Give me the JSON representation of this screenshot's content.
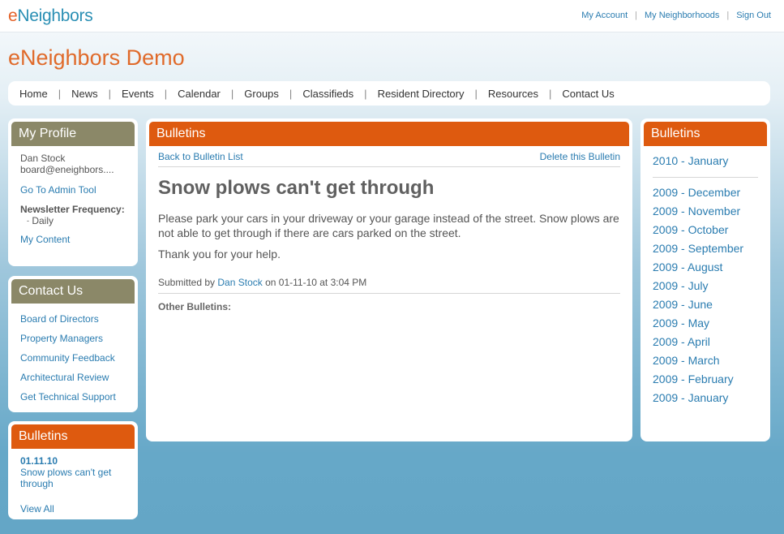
{
  "brand": {
    "logo_e": "e",
    "logo_rest": "Neighbors"
  },
  "toplinks": [
    "My Account",
    "My Neighborhoods",
    "Sign Out"
  ],
  "site_title": "eNeighbors Demo",
  "nav": [
    "Home",
    "News",
    "Events",
    "Calendar",
    "Groups",
    "Classifieds",
    "Resident Directory",
    "Resources",
    "Contact Us"
  ],
  "profile": {
    "title": "My Profile",
    "name": "Dan Stock",
    "email": "board@eneighbors....",
    "admin_link": "Go To Admin Tool",
    "newsletter_label": "Newsletter Frequency:",
    "newsletter_value": "Daily",
    "content_link": "My Content"
  },
  "contact": {
    "title": "Contact Us",
    "links": [
      "Board of Directors",
      "Property Managers",
      "Community Feedback",
      "Architectural Review",
      "Get Technical Support"
    ]
  },
  "bulletins_side": {
    "title": "Bulletins",
    "date": "01.11.10",
    "item": "Snow plows can't get through",
    "view_all": "View All"
  },
  "main": {
    "title": "Bulletins",
    "back_link": "Back to Bulletin List",
    "delete_link": "Delete this Bulletin",
    "bulletin_title": "Snow plows can't get through",
    "body": "Please park your cars in your driveway or your garage instead of the street. Snow plows are not able to get through if there are cars parked on the street.",
    "thanks": "Thank you for your help.",
    "submitted_prefix": "Submitted by",
    "author": "Dan Stock",
    "submitted_suffix": "on 01-11-10 at 3:04 PM",
    "other_label": "Other Bulletins:"
  },
  "archive": {
    "title": "Bulletins",
    "current": "2010 - January",
    "months": [
      "2009 - December",
      "2009 - November",
      "2009 - October",
      "2009 - September",
      "2009 - August",
      "2009 - July",
      "2009 - June",
      "2009 - May",
      "2009 - April",
      "2009 - March",
      "2009 - February",
      "2009 - January"
    ]
  }
}
